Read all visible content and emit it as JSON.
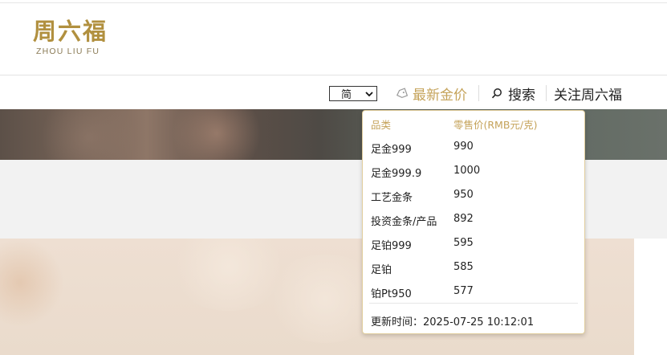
{
  "brand": {
    "name_cn": "周六福",
    "name_en": "ZHOU LIU FU",
    "gold_color": "#b1903f"
  },
  "nav": {
    "language": {
      "selected": "简"
    },
    "gold_price_label": "最新金价",
    "search_label": "搜索",
    "follow_label": "关注周六福",
    "accent_color": "#c5a35a"
  },
  "price_panel": {
    "header_category": "品类",
    "header_price": "零售价(RMB元/克)",
    "rows": [
      {
        "category": "足金999",
        "price": "990"
      },
      {
        "category": "足金999.9",
        "price": "1000"
      },
      {
        "category": "工艺金条",
        "price": "950"
      },
      {
        "category": "投资金条/产品",
        "price": "892"
      },
      {
        "category": "足铂999",
        "price": "595"
      },
      {
        "category": "足铂",
        "price": "585"
      },
      {
        "category": "铂Pt950",
        "price": "577"
      }
    ],
    "update_label": "更新时间：",
    "update_time": "2025-07-25 10:12:01"
  },
  "icons": {
    "gold": "tag-icon",
    "search": "search-icon",
    "lang": "chevron-down-icon"
  }
}
